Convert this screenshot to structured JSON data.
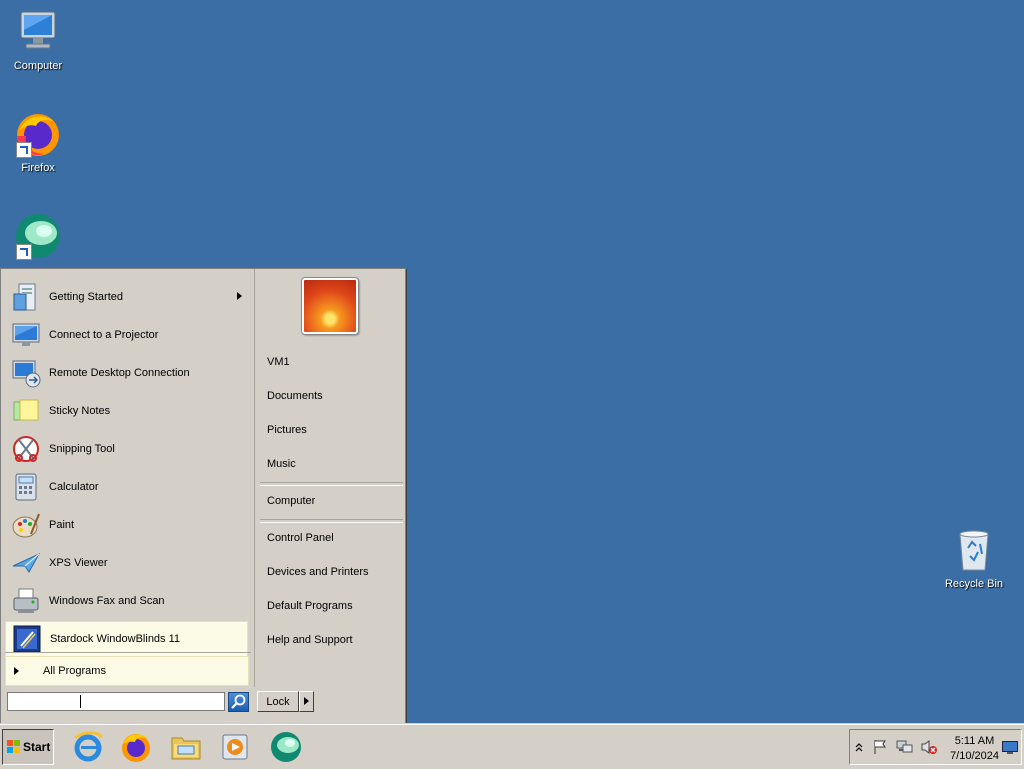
{
  "desktop": {
    "icons": [
      {
        "label": "Computer",
        "icon": "computer-icon"
      },
      {
        "label": "Firefox",
        "icon": "firefox-icon"
      },
      {
        "label": "",
        "icon": "app-globe-icon"
      },
      {
        "label": "Recycle Bin",
        "icon": "recycle-bin-icon"
      }
    ],
    "background_color": "#3a6ea5"
  },
  "start_menu": {
    "programs": [
      {
        "label": "Getting Started",
        "icon": "getting-started-icon",
        "has_submenu": true
      },
      {
        "label": "Connect to a Projector",
        "icon": "projector-icon"
      },
      {
        "label": "Remote Desktop Connection",
        "icon": "remote-desktop-icon"
      },
      {
        "label": "Sticky Notes",
        "icon": "sticky-notes-icon"
      },
      {
        "label": "Snipping Tool",
        "icon": "scissors-icon"
      },
      {
        "label": "Calculator",
        "icon": "calculator-icon"
      },
      {
        "label": "Paint",
        "icon": "paint-palette-icon"
      },
      {
        "label": "XPS Viewer",
        "icon": "xps-viewer-icon"
      },
      {
        "label": "Windows Fax and Scan",
        "icon": "fax-icon"
      },
      {
        "label": "Stardock WindowBlinds 11",
        "icon": "windowblinds-icon",
        "highlighted": true
      }
    ],
    "all_programs": "All Programs",
    "right_items": {
      "user": "VM1",
      "documents": "Documents",
      "pictures": "Pictures",
      "music": "Music",
      "computer": "Computer",
      "control_panel": "Control Panel",
      "devices": "Devices and Printers",
      "default_programs": "Default Programs",
      "help": "Help and Support"
    },
    "search": {
      "value": "",
      "placeholder": ""
    },
    "lock_label": "Lock"
  },
  "taskbar": {
    "start_label": "Start",
    "pinned": [
      "internet-explorer-icon",
      "firefox-icon",
      "file-explorer-icon",
      "media-player-icon",
      "app-globe-icon"
    ],
    "clock": {
      "time": "5:11 AM",
      "date": "7/10/2024"
    }
  }
}
